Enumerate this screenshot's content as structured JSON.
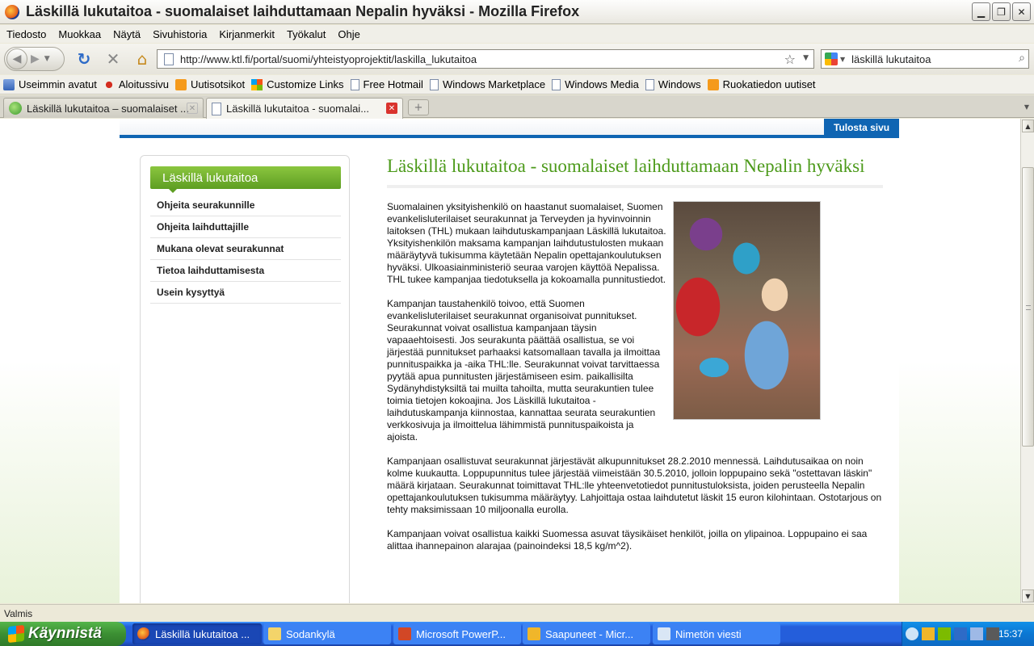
{
  "window": {
    "title": "Läskillä lukutaitoa - suomalaiset laihduttamaan Nepalin hyväksi - Mozilla Firefox"
  },
  "menu": [
    "Tiedosto",
    "Muokkaa",
    "Näytä",
    "Sivuhistoria",
    "Kirjanmerkit",
    "Työkalut",
    "Ohje"
  ],
  "nav": {
    "url": "http://www.ktl.fi/portal/suomi/yhteistyoprojektit/laskilla_lukutaitoa",
    "search_value": "läskillä lukutaitoa"
  },
  "bookmarks": [
    {
      "label": "Useimmin avatut",
      "icon": "folder-icon"
    },
    {
      "label": "Aloitussivu",
      "icon": "msn-icon"
    },
    {
      "label": "Uutisotsikot",
      "icon": "rss-icon"
    },
    {
      "label": "Customize Links",
      "icon": "windows-icon"
    },
    {
      "label": "Free Hotmail",
      "icon": "page-icon"
    },
    {
      "label": "Windows Marketplace",
      "icon": "page-icon"
    },
    {
      "label": "Windows Media",
      "icon": "page-icon"
    },
    {
      "label": "Windows",
      "icon": "page-icon"
    },
    {
      "label": "Ruokatiedon uutiset",
      "icon": "rss-icon"
    }
  ],
  "tabs": [
    {
      "label": "Läskillä lukutaitoa – suomalaiset ..."
    },
    {
      "label": "Läskillä lukutaitoa - suomalai..."
    }
  ],
  "page": {
    "print_label": "Tulosta sivu",
    "sidebar_title": "Läskillä lukutaitoa",
    "sidebar_items": [
      "Ohjeita seurakunnille",
      "Ohjeita laihduttajille",
      "Mukana olevat seurakunnat",
      "Tietoa laihduttamisesta",
      "Usein kysyttyä"
    ],
    "heading": "Läskillä lukutaitoa - suomalaiset laihduttamaan Nepalin hyväksi",
    "paragraphs": [
      "Suomalainen yksityishenkilö on haastanut suomalaiset, Suomen evankelisluterilaiset seurakunnat ja Terveyden ja hyvinvoinnin laitoksen (THL) mukaan laihdutuskampanjaan Läskillä lukutaitoa. Yksityishenkilön maksama kampanjan laihdutustulosten mukaan määräytyvä tukisumma käytetään Nepalin opettajankoulutuksen hyväksi. Ulkoasiainministeriö seuraa varojen käyttöä Nepalissa. THL tukee kampanjaa tiedotuksella ja kokoamalla punnitustiedot.",
      "Kampanjan taustahenkilö toivoo, että Suomen evankelisluterilaiset seurakunnat organisoivat punnitukset. Seurakunnat voivat osallistua kampanjaan täysin vapaaehtoisesti. Jos seurakunta päättää osallistua, se voi järjestää punnitukset parhaaksi katsomallaan tavalla ja ilmoittaa punnituspaikka ja -aika THL:lle. Seurakunnat voivat tarvittaessa pyytää apua punnitusten järjestämiseen esim. paikallisilta Sydänyhdistyksiltä tai muilta tahoilta, mutta seurakuntien tulee toimia tietojen kokoajina. Jos Läskillä lukutaitoa -laihdutuskampanja kiinnostaa, kannattaa seurata seurakuntien verkkosivuja ja ilmoittelua lähimmistä punnituspaikoista ja ajoista.",
      "Kampanjaan osallistuvat seurakunnat järjestävät alkupunnitukset 28.2.2010 mennessä. Laihdutusaikaa on noin kolme kuukautta. Loppupunnitus tulee järjestää viimeistään 30.5.2010, jolloin loppupaino sekä \"ostettavan läskin\" määrä kirjataan. Seurakunnat toimittavat THL:lle yhteenvetotiedot punnitustuloksista, joiden perusteella Nepalin opettajankoulutuksen tukisumma määräytyy. Lahjoittaja ostaa laihdutetut läskit 15 euron kilohintaan. Ostotarjous on tehty maksimissaan 10 miljoonalla eurolla.",
      "Kampanjaan voivat osallistua kaikki Suomessa asuvat täysikäiset henkilöt, joilla on ylipainoa. Loppupaino ei saa alittaa ihannepainon alarajaa (painoindeksi 18,5 kg/m^2)."
    ]
  },
  "status": {
    "text": "Valmis"
  },
  "taskbar": {
    "start_label": "Käynnistä",
    "tasks": [
      "Läskillä lukutaitoa ...",
      "Sodankylä",
      "Microsoft PowerP...",
      "Saapuneet - Micr...",
      "Nimetön viesti"
    ],
    "clock": "15:37"
  }
}
